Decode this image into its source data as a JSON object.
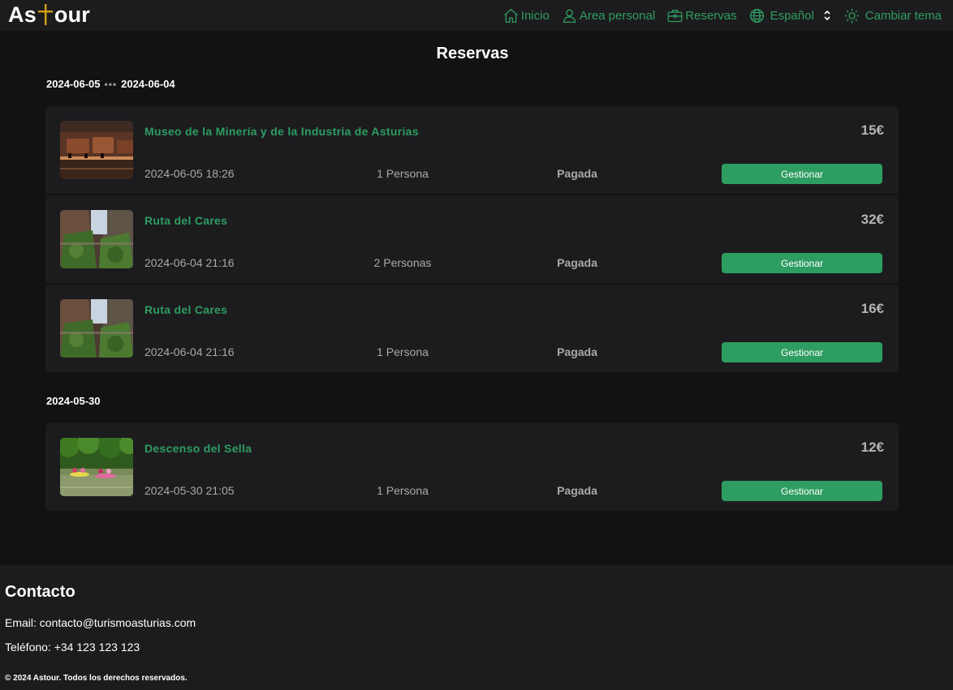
{
  "brand": {
    "name_left": "As",
    "name_right": "our",
    "accent_color": "#d4a017"
  },
  "nav": {
    "home": "Inicio",
    "personal": "Area personal",
    "bookings": "Reservas",
    "language": "Español",
    "theme": "Cambiar tema",
    "color": "#2e9d61"
  },
  "page_title": "Reservas",
  "groups": [
    {
      "date_from": "2024-06-05",
      "date_to": "2024-06-04",
      "bookings": [
        {
          "title": "Museo de la Minería y de la Industria de Asturias",
          "price": "15€",
          "datetime": "2024-06-05 18:26",
          "people": "1 Persona",
          "status": "Pagada",
          "button": "Gestionar",
          "image": "mine-museum-photo"
        },
        {
          "title": "Ruta del Cares",
          "price": "32€",
          "datetime": "2024-06-04 21:16",
          "people": "2 Personas",
          "status": "Pagada",
          "button": "Gestionar",
          "image": "cares-gorge-photo"
        },
        {
          "title": "Ruta del Cares",
          "price": "16€",
          "datetime": "2024-06-04 21:16",
          "people": "1 Persona",
          "status": "Pagada",
          "button": "Gestionar",
          "image": "cares-gorge-photo"
        }
      ]
    },
    {
      "date_from": "2024-05-30",
      "bookings": [
        {
          "title": "Descenso del Sella",
          "price": "12€",
          "datetime": "2024-05-30 21:05",
          "people": "1 Persona",
          "status": "Pagada",
          "button": "Gestionar",
          "image": "sella-canoe-photo"
        }
      ]
    }
  ],
  "footer": {
    "title": "Contacto",
    "email": "Email: contacto@turismoasturias.com",
    "phone": "Teléfono: +34 123 123 123",
    "copyright": "© 2024 Astour. Todos los derechos reservados."
  }
}
